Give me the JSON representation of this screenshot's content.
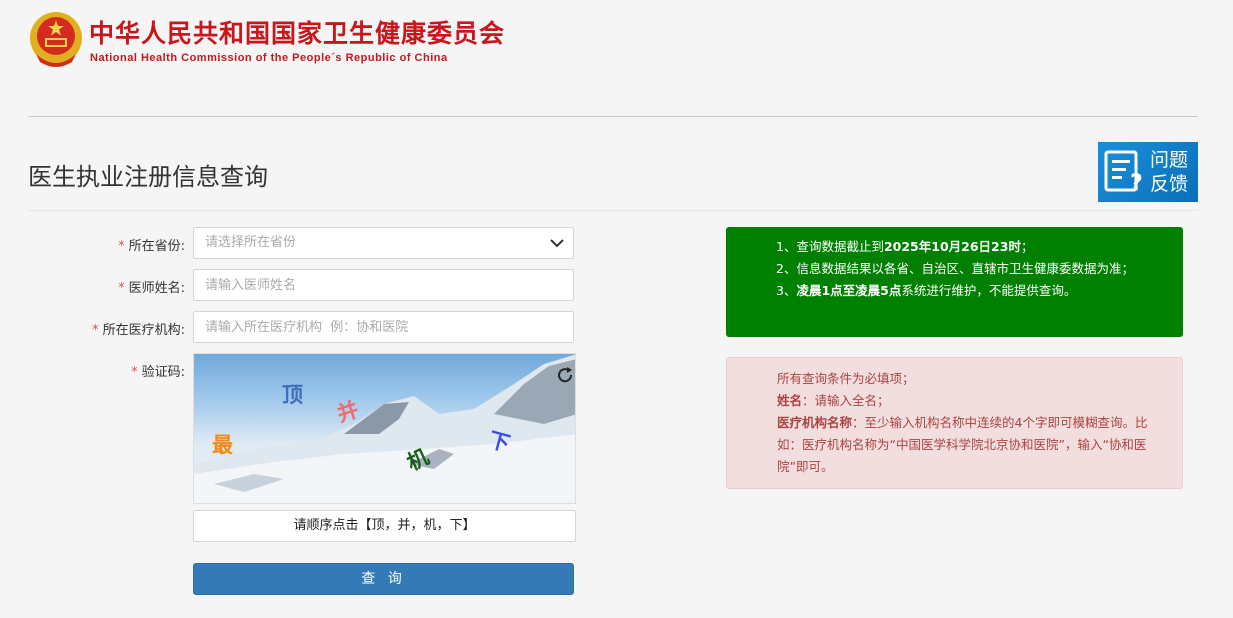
{
  "header": {
    "org_cn": "中华人民共和国国家卫生健康委员会",
    "org_en": "National Health Commission of the People´s Republic of China"
  },
  "page_title": "医生执业注册信息查询",
  "feedback": {
    "line1": "问题",
    "line2": "反馈"
  },
  "form": {
    "province": {
      "label": "所在省份:",
      "placeholder": "请选择所在省份"
    },
    "doctor_name": {
      "label": "医师姓名:",
      "placeholder": "请输入医师姓名"
    },
    "institution": {
      "label": "所在医疗机构:",
      "placeholder": "请输入所在医疗机构  例：协和医院"
    },
    "captcha": {
      "label": "验证码:",
      "chars": [
        "顶",
        "并",
        "最",
        "机",
        "下"
      ],
      "hint": "请顺序点击【顶，并，机，下】"
    },
    "required_mark": "*",
    "submit_label": "查 询"
  },
  "notice_green": {
    "l1_a": "1、查询数据截止到",
    "l1_b": "2025年10月26日23时",
    "l1_c": "；",
    "l2": "2、信息数据结果以各省、自治区、直辖市卫生健康委数据为准；",
    "l3_a": "3、",
    "l3_b": "凌晨1点至凌晨5点",
    "l3_c": "系统进行维护，不能提供查询。"
  },
  "notice_pink": {
    "l1": "所有查询条件为必填项；",
    "l2_b": "姓名",
    "l2": "：请输入全名；",
    "l3_b": "医疗机构名称",
    "l3": "：至少输入机构名称中连续的4个字即可模糊查询。比如：医疗机构名称为“中国医学科学院北京协和医院”，输入“协和医院”即可。"
  },
  "colors": {
    "brand_red": "#c8161d",
    "primary_blue": "#337ab7",
    "notice_green": "#008000",
    "notice_pink": "#f2dede"
  }
}
